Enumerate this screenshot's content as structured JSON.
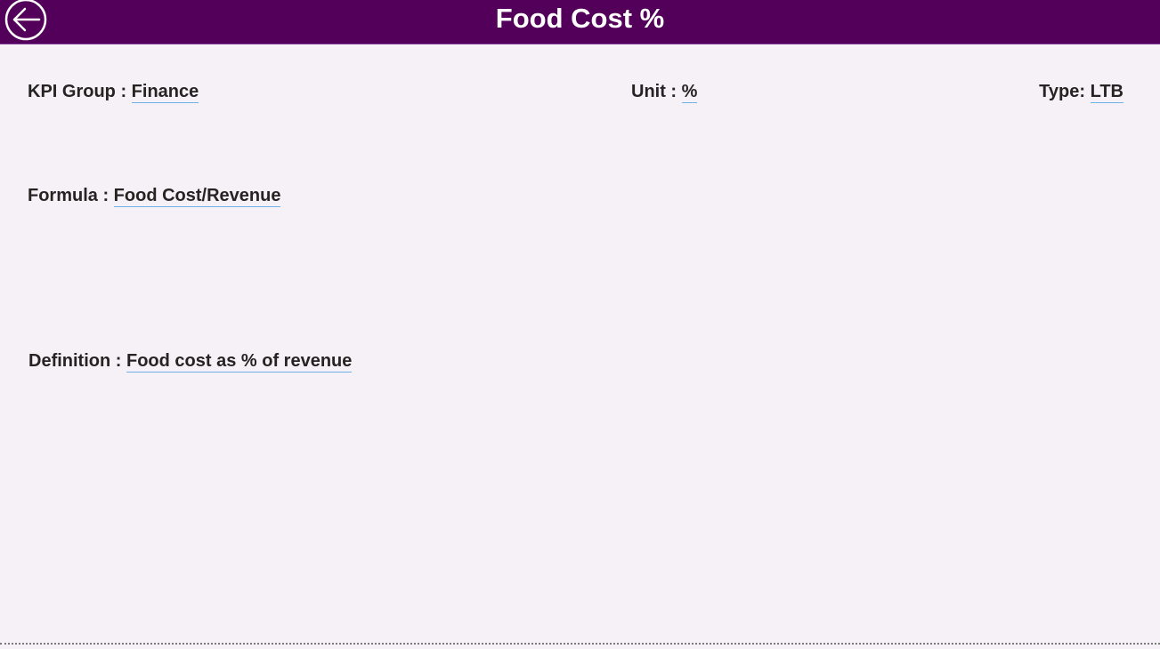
{
  "header": {
    "title": "Food Cost %",
    "back_icon": "arrow-left-circle-icon",
    "background_color": "#520059"
  },
  "fields": {
    "kpi_group": {
      "label": "KPI Group : ",
      "value": "Finance"
    },
    "unit": {
      "label": "Unit : ",
      "value": "%"
    },
    "type": {
      "label": "Type: ",
      "value": "LTB"
    },
    "formula": {
      "label": "Formula : ",
      "value": "Food Cost/Revenue"
    },
    "definition": {
      "label": "Definition : ",
      "value": "Food cost as % of revenue"
    }
  },
  "colors": {
    "page_background": "#F5F1F7",
    "text": "#252423",
    "value_underline": "#6fb2e6"
  }
}
